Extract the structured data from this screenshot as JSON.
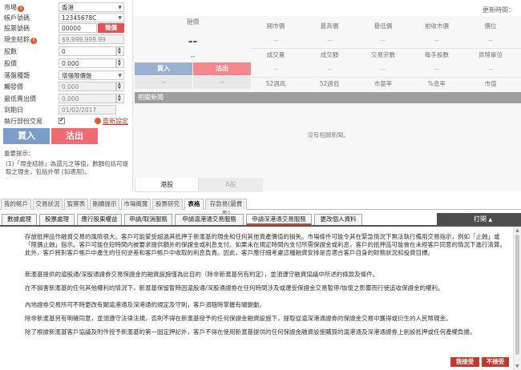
{
  "order_form": {
    "fields": {
      "market": {
        "label": "市場",
        "value": "香港"
      },
      "account": {
        "label": "帳戶號碼",
        "value": "12345678C"
      },
      "stock_code": {
        "label": "股票號碼",
        "value": "00000",
        "lookup_label": "報價"
      },
      "cash_balance": {
        "label": "現金結餘",
        "value": "$9,999,999.99"
      },
      "quantity": {
        "label": "股數",
        "value": "0"
      },
      "price": {
        "label": "股價",
        "value": "0.000"
      },
      "order_type": {
        "label": "落盤種類",
        "value": "增強限價盤"
      },
      "trigger_price": {
        "label": "觸發價",
        "value": "0.000"
      },
      "max_sell_price": {
        "label": "最低賣出價",
        "value": "0.000"
      },
      "expiry_date": {
        "label": "到期日",
        "value": "01/02/2017"
      },
      "odd_lot": {
        "label": "執行部份交易"
      }
    },
    "reset_label": "重新設定",
    "buy_label": "買入",
    "sell_label": "沽出",
    "notes_title": "重要提示：",
    "notes_text": "(1)「現金結餘」為還元之等值，數額包括可提取之現金，包括外幣 (如適用)。"
  },
  "quote": {
    "update_time_label": "更新時間：",
    "current_price_label": "現價",
    "big_dash": "--",
    "small_dash": "--",
    "buy_label": "買入",
    "sell_label": "沽出",
    "bid": "--",
    "ask": "--",
    "grid": [
      [
        "開市價",
        "最高價",
        "最低價",
        "前收市價",
        "價位"
      ],
      [
        "--",
        "--",
        "--",
        "--",
        "--"
      ],
      [
        "成交量",
        "成交額",
        "交易宗數",
        "每手股數",
        "貨幣單位"
      ],
      [
        "--",
        "--",
        "--",
        "--",
        "--"
      ],
      [
        "52週高",
        "52週低",
        "市盈率",
        "%息率",
        "市值"
      ],
      [
        "--",
        "--",
        "--",
        "--",
        "--"
      ]
    ],
    "news_title": "相關新聞",
    "news_empty": "沒有相關新聞。",
    "market_tabs": [
      "港股",
      "A股"
    ]
  },
  "main_tabs": [
    "我的帳戶",
    "交易狀況",
    "監察表",
    "刪續提示",
    "市場概覽",
    "股票研究",
    "表格",
    "存款易(最費盈)"
  ],
  "active_main_tab": "表格",
  "sub_tabs": [
    "數據處理",
    "股票處理",
    "應行股東權益",
    "申請/取消服務",
    "申請滬港通交易服務",
    "申請深港通交易服務",
    "更改個人資料"
  ],
  "active_sub_tab": "申請深港通交易服務",
  "print_label": "打開",
  "doc": {
    "paragraphs": [
      "存放抵押品作融資交易的風險很大。客戶可能蒙受超過其抵押于新滙基的現金和任何其他資產價值的損失。市場條件可能令其在緊急情況下無法執行備用交易指示，例如「止蝕」或「限價止蝕」指示。客戶可能在短時間内被要求提供額外的保證金或利息支付。如果未在規定時間內支付所需保證金或利息，客戶的抵押品可能會在未經客戶同意的情況下進行清算。此外，客戶將對客戶帳戶中產生的任何逆差和客戶帳戶中收取的利息負責。因此，客戶應仔細考慮這種融資安排是否適合客戶自身的財務狀況和投資目標。",
      "新滙基提供的滬股通/深股通證券交易保證金的融資設施僅為此目的（除非新滙基另有約定），並須遵守融資協議中所述的條款及條件。",
      "在不損害新滙基的任何其他權利的情況下，新滙基保留暫時因滬股通/深股通證券在任何時間涉及或遭受保證金交易暫停/恢復之影響而行使追收保證金的權利。",
      "內地證券交易所可不時更改有關滬港通及深港通的規定及守則，客戶須隨時掌握有關變動。",
      "除非新滙基另有明確同意，並須遵守法律法規，否則不得在新滙基授予的任何保證金融資設施下，提取從滬深港通證券的保證金交易中獲得或衍生的人民幣現金。",
      "除了根據新滙基客戶協議及附件授予新滙基的第一固定押記外，客戶不得在使用新滙基提供的任何保證金融資設施購買的滬港通及深港通證券上創設抵押或任何產權負擔。"
    ]
  },
  "actions": {
    "accept_label": "我接受",
    "decline_label": "不接受"
  },
  "colors": {
    "buy": "#7c9cc9",
    "sell": "#f06a72",
    "accent_red": "#c0392b",
    "news_header": "#9e9e9e"
  }
}
